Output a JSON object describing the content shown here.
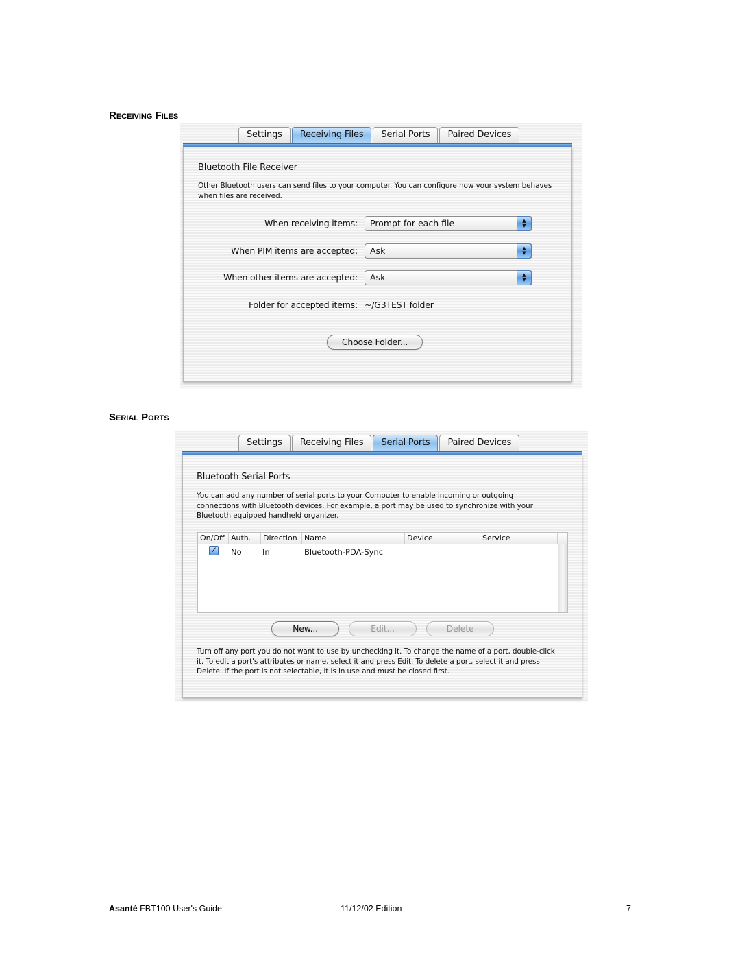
{
  "sections": {
    "receiving_files_heading": "Receiving Files",
    "serial_ports_heading": "Serial Ports"
  },
  "tabs": [
    {
      "label": "Settings"
    },
    {
      "label": "Receiving Files"
    },
    {
      "label": "Serial Ports"
    },
    {
      "label": "Paired Devices"
    }
  ],
  "receiving_files": {
    "active_tab": "Receiving Files",
    "title": "Bluetooth File Receiver",
    "description": "Other Bluetooth users can send files to your computer. You can configure how your system behaves when files are received.",
    "rows": [
      {
        "label": "When receiving items:",
        "value": "Prompt for each file"
      },
      {
        "label": "When PIM items are accepted:",
        "value": "Ask"
      },
      {
        "label": "When other items are accepted:",
        "value": "Ask"
      }
    ],
    "folder_label": "Folder for accepted items:",
    "folder_value": "~/G3TEST folder",
    "choose_folder_button": "Choose Folder..."
  },
  "serial_ports": {
    "active_tab": "Serial Ports",
    "title": "Bluetooth Serial Ports",
    "description": "You can add any number of serial ports to your Computer to enable incoming or outgoing connections with Bluetooth devices.  For example, a port may be used to synchronize with your Bluetooth equipped handheld organizer.",
    "columns": [
      "On/Off",
      "Auth.",
      "Direction",
      "Name",
      "Device",
      "Service"
    ],
    "rows": [
      {
        "on": true,
        "auth": "No",
        "direction": "In",
        "name": "Bluetooth-PDA-Sync",
        "device": "",
        "service": ""
      }
    ],
    "buttons": {
      "new": "New...",
      "edit": "Edit...",
      "delete": "Delete"
    },
    "help_text": "Turn off any port you do not want to use by unchecking it. To change the name of a port, double-click it. To edit a port's attributes or name, select it and press Edit. To delete a port, select it and press Delete. If the port is not selectable, it is in use and must be closed first."
  },
  "footer": {
    "brand": "Asanté",
    "guide": "FBT100 User's Guide",
    "edition": "11/12/02 Edition",
    "page_number": "7"
  },
  "colors": {
    "active_tab": "#8fc1ee",
    "accent_blue": "#4a7fc4"
  }
}
